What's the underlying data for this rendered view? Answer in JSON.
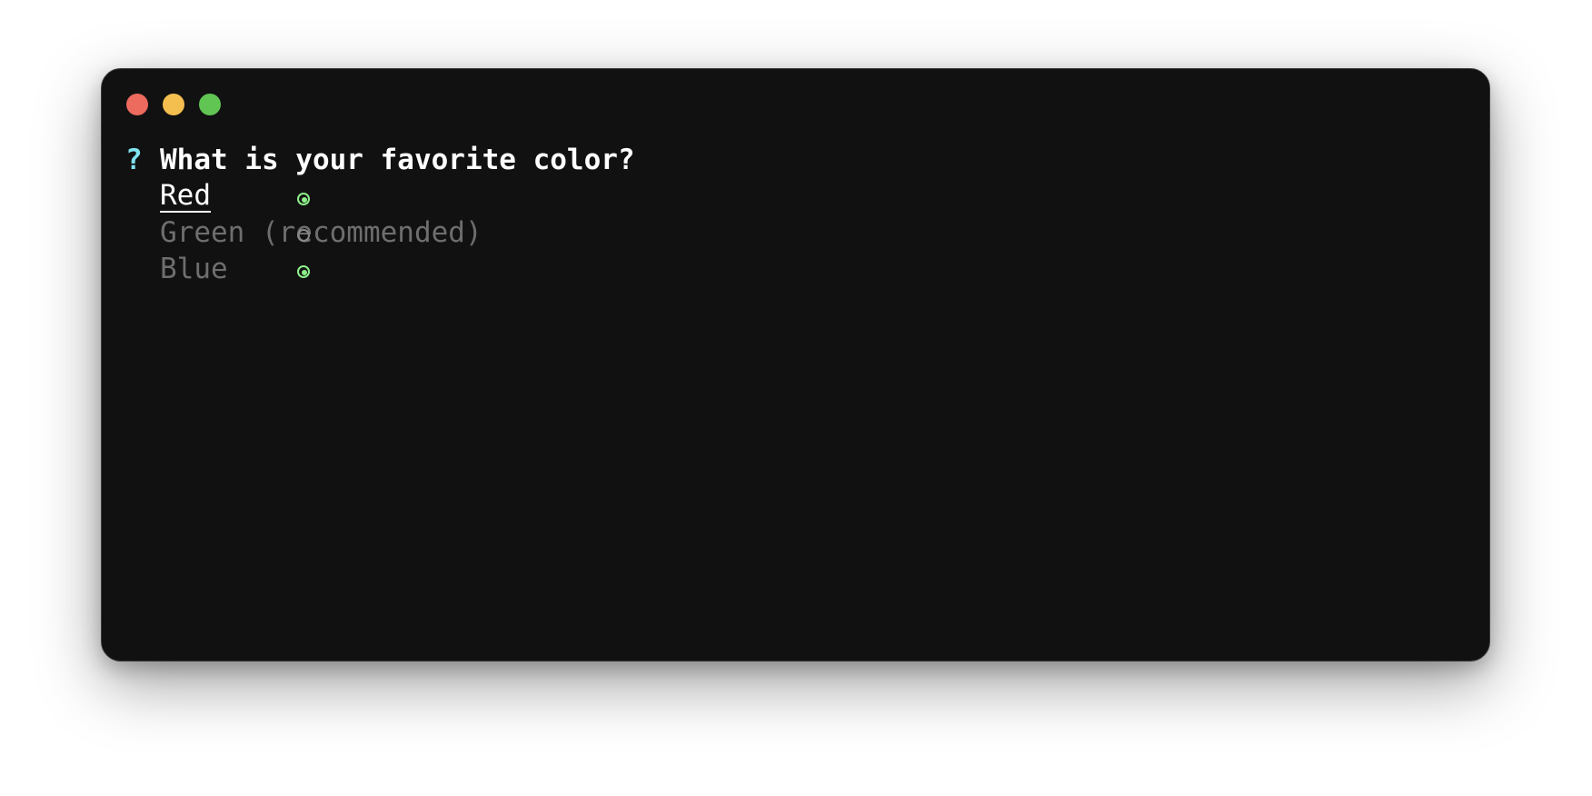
{
  "colors": {
    "window_bg": "#111111",
    "close": "#ed6a5e",
    "minimize": "#f5bf4f",
    "zoom": "#61c554",
    "prompt_mark": "#7fe3f0",
    "checked_radio": "#8ef08a",
    "unchecked_radio": "#8a8a8a",
    "active_text": "#ffffff",
    "inactive_text": "#6e6e6e"
  },
  "prompt": {
    "mark": "?",
    "question": "What is your favorite color?"
  },
  "options": [
    {
      "label": "Red",
      "checked": true,
      "highlighted": true
    },
    {
      "label": "Green (recommended)",
      "checked": false,
      "highlighted": false
    },
    {
      "label": "Blue",
      "checked": true,
      "highlighted": false
    }
  ]
}
